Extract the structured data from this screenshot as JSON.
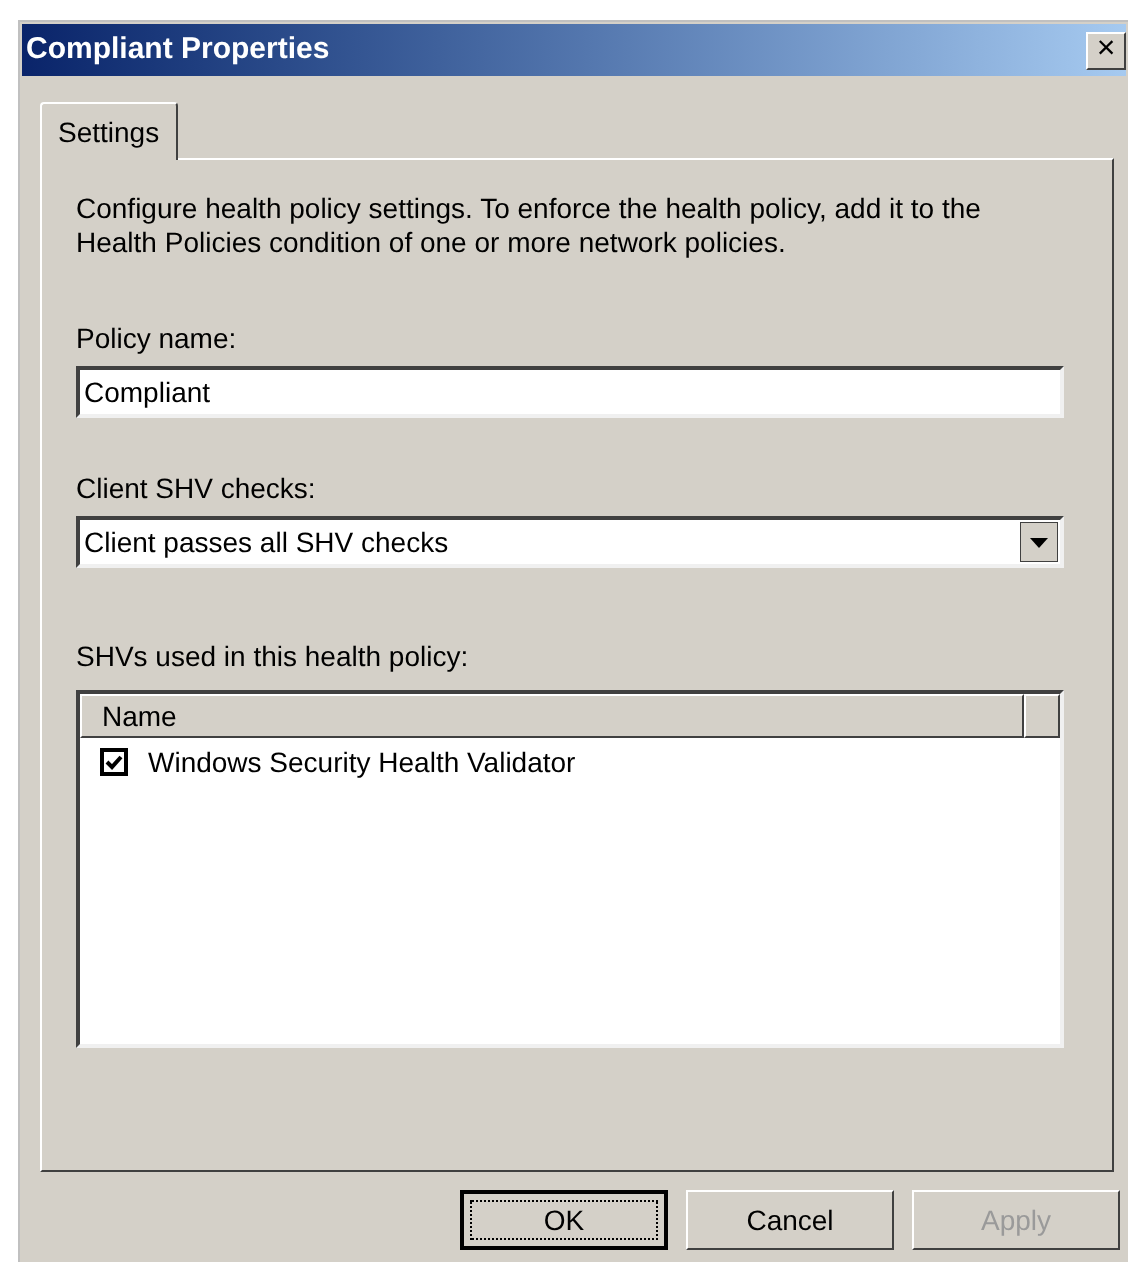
{
  "window": {
    "title": "Compliant Properties",
    "close": "×"
  },
  "tabs": [
    {
      "label": "Settings",
      "selected": true
    }
  ],
  "description": "Configure health policy settings. To enforce the health policy, add it to the Health Policies condition of one or more network policies.",
  "policy_name": {
    "label": "Policy name:",
    "value": "Compliant"
  },
  "client_checks": {
    "label": "Client SHV checks:",
    "value": "Client passes all SHV checks"
  },
  "shvs": {
    "label": "SHVs used in this health policy:",
    "columns": [
      "Name"
    ],
    "rows": [
      {
        "name": "Windows Security Health Validator",
        "checked": true
      }
    ]
  },
  "buttons": [
    {
      "label": "OK",
      "default": true,
      "disabled": false
    },
    {
      "label": "Cancel",
      "default": false,
      "disabled": false
    },
    {
      "label": "Apply",
      "default": false,
      "disabled": true
    }
  ]
}
